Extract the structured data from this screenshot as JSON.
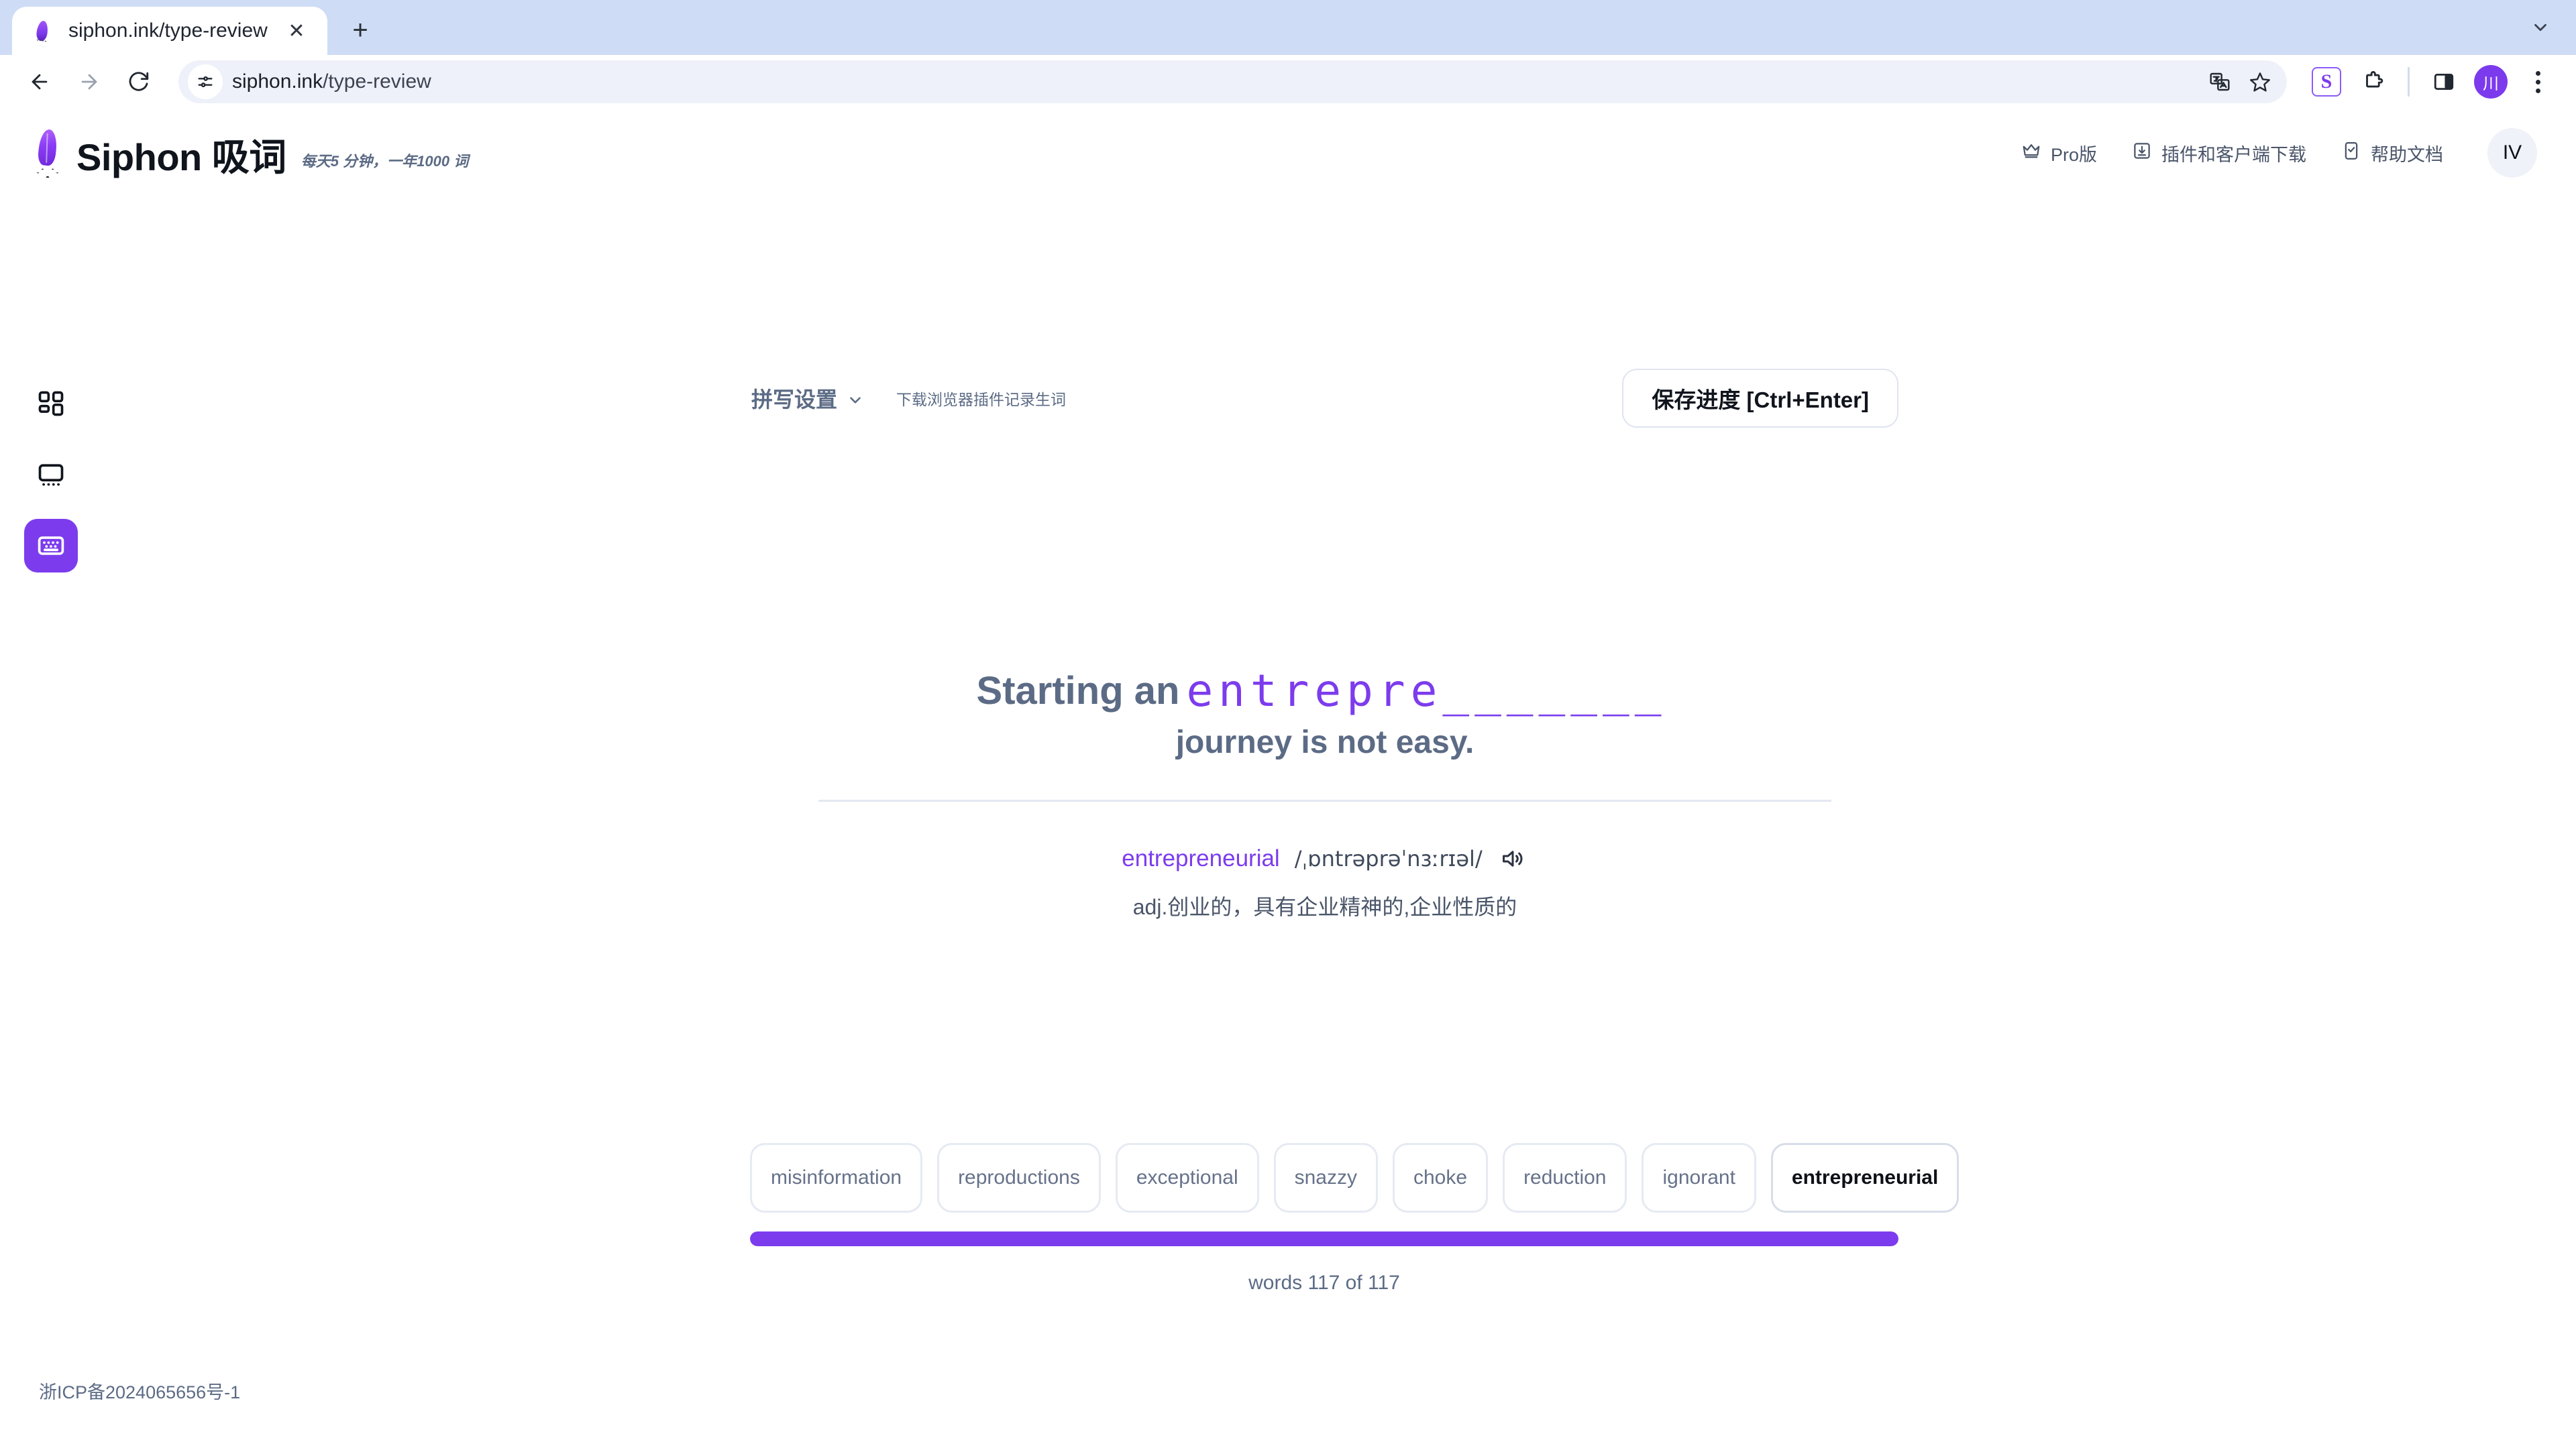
{
  "browser": {
    "tab": {
      "title": "siphon.ink/type-review",
      "favicon": "feather-icon",
      "close_label": "✕"
    },
    "new_tab_label": "+",
    "nav": {
      "back": "back-arrow",
      "forward": "forward-arrow",
      "reload": "reload-icon"
    },
    "omnibox": {
      "url_prefix": "siphon.ink",
      "url_suffix": "/type-review",
      "site_info_icon": "page-settings-icon",
      "translate_icon": "translate-icon",
      "bookmark_icon": "star-icon"
    },
    "toolbar_icons": {
      "siphon_extension": "S",
      "extensions": "puzzle-icon",
      "side_panel": "side-panel-icon",
      "profile_initial": "川",
      "menu": "kebab-menu-icon"
    }
  },
  "header": {
    "brand_name": "Siphon 吸词",
    "tagline": "每天5 分钟，一年1000 词",
    "nav": [
      {
        "label": "Pro版",
        "icon": "crown-icon"
      },
      {
        "label": "插件和客户端下载",
        "icon": "download-icon"
      },
      {
        "label": "帮助文档",
        "icon": "doc-check-icon"
      }
    ],
    "avatar_initials": "IV"
  },
  "sidebar": {
    "items": [
      {
        "icon": "grid-dashboard-icon",
        "name": "dashboard",
        "active": false
      },
      {
        "icon": "monitor-icon",
        "name": "display",
        "active": false
      },
      {
        "icon": "keyboard-icon",
        "name": "typing",
        "active": true
      }
    ]
  },
  "toolbar": {
    "spelling_settings_label": "拼写设置",
    "chevron_icon": "chevron-down-icon",
    "plugin_hint": "下载浏览器插件记录生词",
    "save_label": "保存进度 [Ctrl+Enter]"
  },
  "exercise": {
    "sentence_prefix": "Starting an",
    "typed_letters": "entrepre",
    "remaining_letters": "_______",
    "sentence_line2": "journey is not easy.",
    "word": {
      "headword": "entrepreneurial",
      "phonetic": "/ˌɒntrəprəˈnɜːrɪəl/",
      "speaker_icon": "speaker-icon",
      "definition": "adj.创业的，具有企业精神的,企业性质的"
    }
  },
  "chips": [
    {
      "label": "misinformation",
      "active": false
    },
    {
      "label": "reproductions",
      "active": false
    },
    {
      "label": "exceptional",
      "active": false
    },
    {
      "label": "snazzy",
      "active": false
    },
    {
      "label": "choke",
      "active": false
    },
    {
      "label": "reduction",
      "active": false
    },
    {
      "label": "ignorant",
      "active": false
    },
    {
      "label": "entrepreneurial",
      "active": true
    }
  ],
  "progress": {
    "percent": 100,
    "label": "words 117 of 117",
    "current": 117,
    "total": 117,
    "fill_color": "#7c3ced"
  },
  "footer": {
    "icp": "浙ICP备2024065656号-1"
  }
}
